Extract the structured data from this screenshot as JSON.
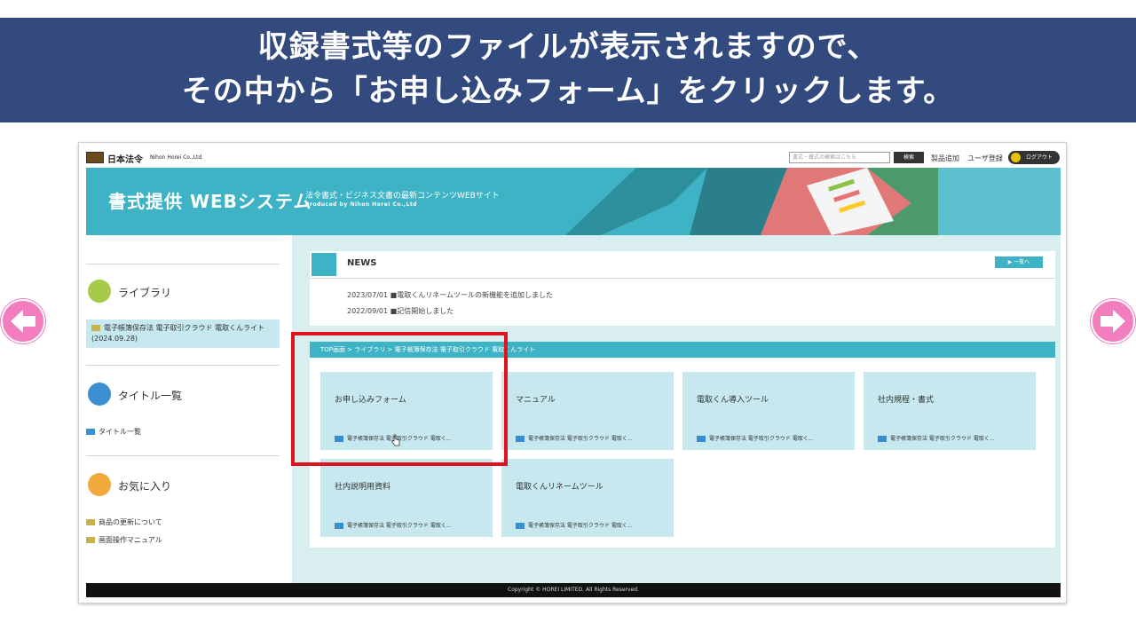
{
  "caption": {
    "line1": "収録書式等のファイルが表示されますので、",
    "line2": "その中から「お申し込みフォーム」をクリックします。"
  },
  "nav": {
    "prev": "arrow-left-icon",
    "next": "arrow-right-icon"
  },
  "colors": {
    "caption_bg": "#334a7e",
    "accent": "#3eb3c5",
    "tile": "#c7e8ee",
    "highlight": "#e0141e",
    "arrow": "#f27ebd"
  },
  "site": {
    "logo_jp": "日本法令",
    "logo_en": "Nihon Horei Co.,Ltd",
    "search_placeholder": "書式・様式の検索はこちら",
    "search_button": "検索",
    "link_add": "製品追加",
    "link_register": "ユーザ登録",
    "logout": "ログアウト",
    "banner_title": "書式提供 WEBシステム",
    "banner_sub": "法令書式・ビジネス文書の最新コンテンツWEBサイト",
    "banner_en": "Produced by Nihon Horei Co.,Ltd"
  },
  "sidebar": {
    "library_label": "ライブラリ",
    "library_item": "電子帳簿保存法 電子取引クラウド 電取くんライト",
    "library_item_date": "(2024.09.28)",
    "title_list_label": "タイトル一覧",
    "title_list_item": "タイトル一覧",
    "favorites_label": "お気に入り",
    "favorites_items": [
      "商品の更新について",
      "画面操作マニュアル"
    ]
  },
  "news": {
    "title": "NEWS",
    "more": "▶ 一覧へ",
    "items": [
      {
        "date": "2023/07/01",
        "text": "■電取くんリネームツールの新機能を追加しました"
      },
      {
        "date": "2022/09/01",
        "text": "■記信開始しました"
      }
    ]
  },
  "breadcrumb": "TOP画面 > ライブラリ > 電子帳簿保存法 電子取引クラウド 電取くんライト",
  "tiles": [
    {
      "title": "お申し込みフォーム",
      "foot": "電子帳簿保存法 電子取引クラウド 電取く..."
    },
    {
      "title": "マニュアル",
      "foot": "電子帳簿保存法 電子取引クラウド 電取く..."
    },
    {
      "title": "電取くん導入ツール",
      "foot": "電子帳簿保存法 電子取引クラウド 電取く..."
    },
    {
      "title": "社内規程・書式",
      "foot": "電子帳簿保存法 電子取引クラウド 電取く..."
    },
    {
      "title": "社内説明用資料",
      "foot": "電子帳簿保存法 電子取引クラウド 電取く..."
    },
    {
      "title": "電取くんリネームツール",
      "foot": "電子帳簿保存法 電子取引クラウド 電取く..."
    }
  ],
  "footer": "Copyright © HOREI LIMITED. All Rights Reserved."
}
